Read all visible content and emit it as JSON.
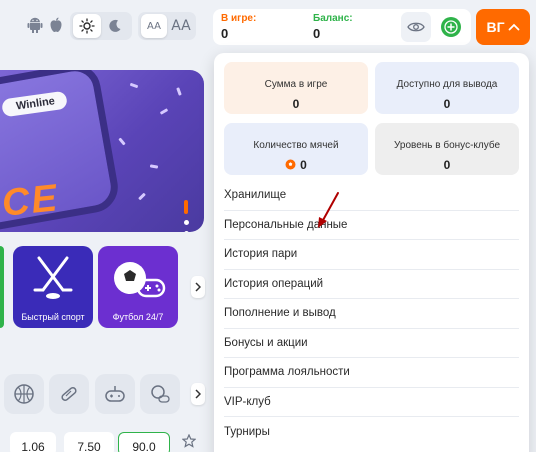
{
  "header": {
    "in_game_label": "В игре:",
    "in_game_value": "0",
    "balance_label": "Баланс:",
    "balance_value": "0",
    "avatar_initials": "ВГ",
    "font_small": "AA",
    "font_large": "AA"
  },
  "banner": {
    "brand": "Winline",
    "text": "CE"
  },
  "tiles": [
    {
      "label": "Быстрый спорт"
    },
    {
      "label": "Футбол 24/7"
    }
  ],
  "odds": [
    "1.06",
    "7.50",
    "90.0"
  ],
  "panel": {
    "cards": [
      {
        "label": "Сумма в игре",
        "value": "0"
      },
      {
        "label": "Доступно для вывода",
        "value": "0"
      },
      {
        "label": "Количество мячей",
        "value": "0"
      },
      {
        "label": "Уровень в бонус-клубе",
        "value": "0"
      }
    ],
    "menu": [
      {
        "label": "Хранилище"
      },
      {
        "label": "Персональные данные"
      },
      {
        "label": "История пари"
      },
      {
        "label": "История операций"
      },
      {
        "label": "Пополнение и вывод"
      },
      {
        "label": "Бонусы и акции"
      },
      {
        "label": "Программа лояльности"
      },
      {
        "label": "VIP-клуб"
      },
      {
        "label": "Турниры"
      }
    ]
  },
  "colors": {
    "accent": "#ff6a00",
    "in_game_label": "#ff6a00",
    "balance_label": "#2fb34a",
    "plus_green": "#2fb34a",
    "card_sum_bg": "#fdf0e6",
    "card_withdraw_bg": "#e9eefa",
    "card_balls_bg": "#e9eefa",
    "card_level_bg": "#eeeeee",
    "annotation_arrow": "#b00000"
  },
  "icons": {
    "android": "android-icon",
    "apple": "apple-icon",
    "sun": "sun-icon",
    "moon": "moon-icon",
    "eye": "eye-icon",
    "plus": "plus-icon",
    "chevron": "chevron-up-icon",
    "ball": "ball-icon",
    "star": "star-icon"
  }
}
